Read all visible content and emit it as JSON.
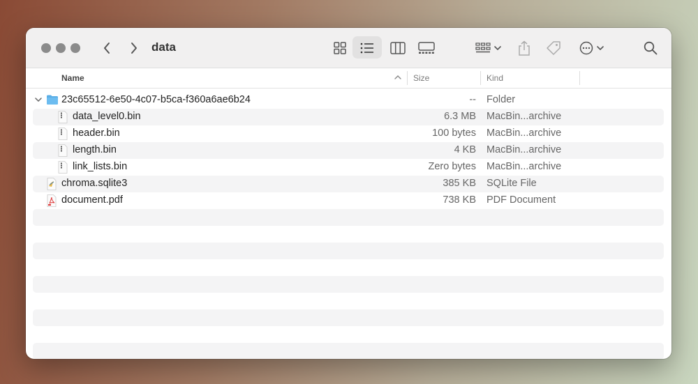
{
  "window": {
    "title": "data"
  },
  "toolbar": {
    "buttons": [
      "back-icon",
      "forward-icon",
      "icon-view",
      "list-view",
      "column-view",
      "gallery-view",
      "group-by",
      "share",
      "tags",
      "more-actions",
      "search"
    ]
  },
  "columns": {
    "name": "Name",
    "size": "Size",
    "kind": "Kind"
  },
  "rows": [
    {
      "name": "23c65512-6e50-4c07-b5ca-f360a6ae6b24",
      "size": "--",
      "kind": "Folder",
      "icon": "folder-icon",
      "expanded": true,
      "indent": 0
    },
    {
      "name": "data_level0.bin",
      "size": "6.3 MB",
      "kind": "MacBin...archive",
      "icon": "binary-file-icon",
      "indent": 1
    },
    {
      "name": "header.bin",
      "size": "100 bytes",
      "kind": "MacBin...archive",
      "icon": "binary-file-icon",
      "indent": 1
    },
    {
      "name": "length.bin",
      "size": "4 KB",
      "kind": "MacBin...archive",
      "icon": "binary-file-icon",
      "indent": 1
    },
    {
      "name": "link_lists.bin",
      "size": "Zero bytes",
      "kind": "MacBin...archive",
      "icon": "binary-file-icon",
      "indent": 1
    },
    {
      "name": "chroma.sqlite3",
      "size": "385 KB",
      "kind": "SQLite File",
      "icon": "sqlite-file-icon",
      "indent": 0
    },
    {
      "name": "document.pdf",
      "size": "738 KB",
      "kind": "PDF Document",
      "icon": "pdf-file-icon",
      "indent": 0
    }
  ],
  "colors": {
    "folder": "#5aaee6",
    "pdf": "#d33",
    "traffic_light": "#8b8b8b",
    "stripe": "#f4f4f5"
  }
}
